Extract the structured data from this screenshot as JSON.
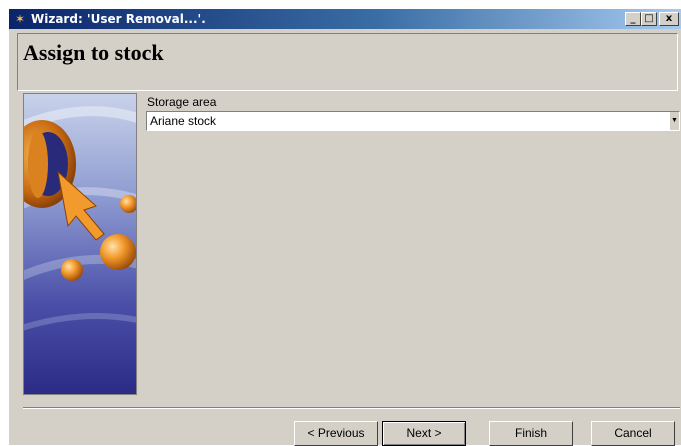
{
  "window": {
    "title": "Wizard: 'User Removal...'.",
    "min_icon": "minimize-icon",
    "max_icon": "maximize-icon",
    "close_icon": "close-icon",
    "min_glyph": "_",
    "max_glyph": "□",
    "close_glyph": "x"
  },
  "header": {
    "title": "Assign to stock"
  },
  "side_image": {
    "icon": "wizard-graphic"
  },
  "form": {
    "storage_area_label": "Storage area",
    "storage_area_value": "Ariane stock"
  },
  "buttons": {
    "previous": "< Previous",
    "next": "Next >",
    "finish": "Finish",
    "cancel": "Cancel"
  },
  "colors": {
    "title_start": "#0a246a",
    "title_end": "#a6caf0",
    "face": "#d4d0c8"
  }
}
